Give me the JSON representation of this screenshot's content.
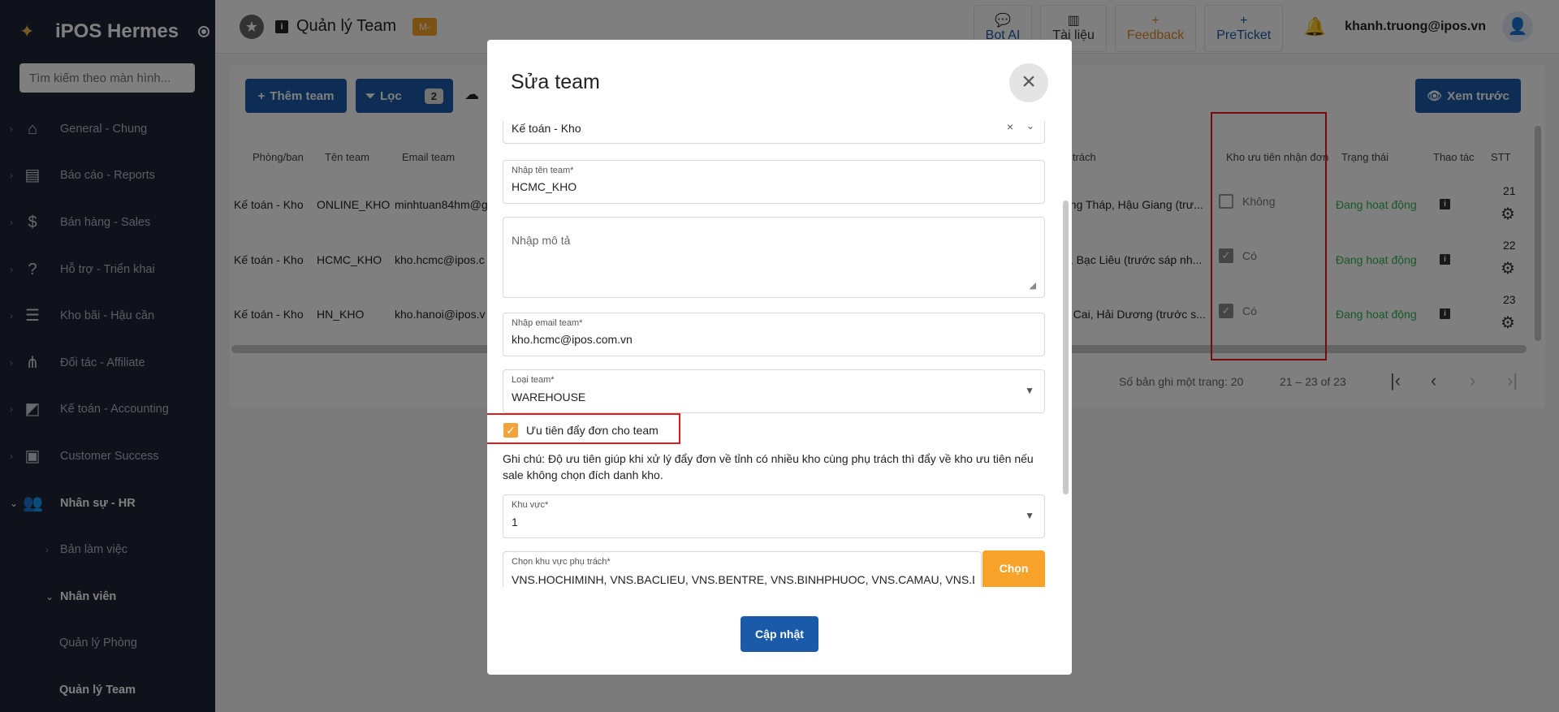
{
  "sidebar": {
    "brand": "iPOS Hermes",
    "search_placeholder": "Tìm kiếm theo màn hình...",
    "items": [
      {
        "label": "General - Chung"
      },
      {
        "label": "Báo cáo - Reports"
      },
      {
        "label": "Bán hàng - Sales"
      },
      {
        "label": "Hỗ trợ - Triển khai"
      },
      {
        "label": "Kho bãi - Hậu cần"
      },
      {
        "label": "Đối tác - Affiliate"
      },
      {
        "label": "Kế toán - Accounting"
      },
      {
        "label": "Customer Success"
      },
      {
        "label": "Nhân sự - HR"
      }
    ],
    "sub_items": [
      {
        "label": "Bản làm việc"
      },
      {
        "label": "Nhân viên"
      },
      {
        "label": "Quản lý Phòng"
      },
      {
        "label": "Quản lý Team"
      }
    ]
  },
  "topbar": {
    "title": "Quản lý Team",
    "badge": "M-",
    "buttons": [
      {
        "label": "Bot AI"
      },
      {
        "label": "Tài liệu"
      },
      {
        "label": "Feedback"
      },
      {
        "label": "PreTicket"
      }
    ],
    "user_email": "khanh.truong@ipos.vn"
  },
  "toolbar": {
    "add_label": "Thêm team",
    "filter_label": "Lọc",
    "filter_count": "2",
    "preview_label": "Xem trước"
  },
  "table": {
    "headers": {
      "dept": "Phòng/ban",
      "name": "Tên team",
      "email": "Email team",
      "area": "ụ trách",
      "priority": "Kho ưu tiên nhận đơn",
      "status": "Trạng thái",
      "action": "Thao tác",
      "stt": "STT"
    },
    "rows": [
      {
        "dept": "Kế toán - Kho",
        "name": "ONLINE_KHO",
        "email": "minhtuan84hm@g",
        "area": "ồng Tháp, Hậu Giang (trư...",
        "priority": "Không",
        "priority_checked": false,
        "status": "Đang hoạt động",
        "stt": "21"
      },
      {
        "dept": "Kế toán - Kho",
        "name": "HCMC_KHO",
        "email": "kho.hcmc@ipos.c",
        "area": "h, Bạc Liêu (trước sáp nh...",
        "priority": "Có",
        "priority_checked": true,
        "status": "Đang hoạt động",
        "stt": "22"
      },
      {
        "dept": "Kế toán - Kho",
        "name": "HN_KHO",
        "email": "kho.hanoi@ipos.v",
        "area": "o Cai, Hải Dương (trước s...",
        "priority": "Có",
        "priority_checked": true,
        "status": "Đang hoạt động",
        "stt": "23"
      }
    ]
  },
  "pager": {
    "per_page": "Số bản ghi một trang: 20",
    "range": "21 – 23 of 23"
  },
  "modal": {
    "title": "Sửa team",
    "dept_value": "Kế toán - Kho",
    "name_label": "Nhập tên team*",
    "name_value": "HCMC_KHO",
    "desc_placeholder": "Nhập mô tả",
    "email_label": "Nhập email team*",
    "email_value": "kho.hcmc@ipos.com.vn",
    "type_label": "Loại team*",
    "type_value": "WAREHOUSE",
    "priority_label": "Ưu tiên đẩy đơn cho team",
    "note": "Ghi chú: Độ ưu tiên giúp khi xử lý đẩy đơn về tỉnh có nhiều kho cùng phụ trách thì đẩy về kho ưu tiên nếu sale không chọn đích danh kho.",
    "region_label": "Khu vực*",
    "region_value": "1",
    "area_label": "Chọn khu vực phụ trách*",
    "area_value": "VNS.HOCHIMINH, VNS.BACLIEU, VNS.BENTRE, VNS.BINHPHUOC, VNS.CAMAU, VNS.DONGNAI",
    "choose_label": "Chọn",
    "update_label": "Cập nhật"
  },
  "colors": {
    "primary": "#1a5aa8",
    "accent": "#f7a229",
    "status_green": "#2fb24f",
    "highlight": "#e21b1b"
  }
}
